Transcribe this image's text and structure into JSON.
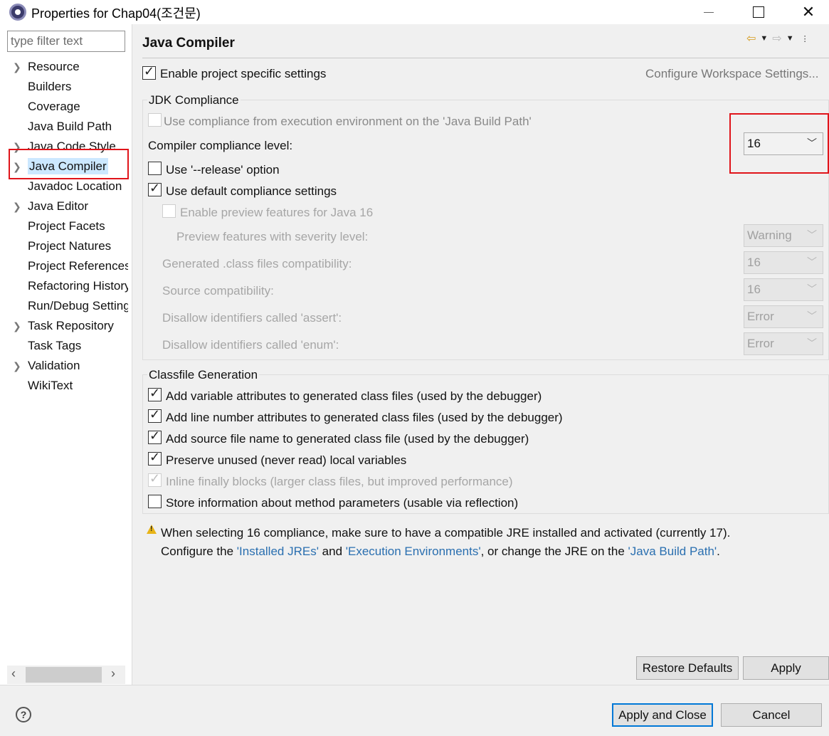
{
  "window": {
    "title": "Properties for Chap04(조건문)",
    "close_glyph": "✕"
  },
  "sidebar": {
    "filter_placeholder": "type filter text",
    "items": [
      {
        "label": "Resource",
        "expandable": true
      },
      {
        "label": "Builders",
        "expandable": false
      },
      {
        "label": "Coverage",
        "expandable": false
      },
      {
        "label": "Java Build Path",
        "expandable": false
      },
      {
        "label": "Java Code Style",
        "expandable": true
      },
      {
        "label": "Java Compiler",
        "expandable": true,
        "selected": true
      },
      {
        "label": "Javadoc Location",
        "expandable": false
      },
      {
        "label": "Java Editor",
        "expandable": true
      },
      {
        "label": "Project Facets",
        "expandable": false
      },
      {
        "label": "Project Natures",
        "expandable": false
      },
      {
        "label": "Project References",
        "expandable": false
      },
      {
        "label": "Refactoring History",
        "expandable": false
      },
      {
        "label": "Run/Debug Settings",
        "expandable": false
      },
      {
        "label": "Task Repository",
        "expandable": true
      },
      {
        "label": "Task Tags",
        "expandable": false
      },
      {
        "label": "Validation",
        "expandable": true
      },
      {
        "label": "WikiText",
        "expandable": false
      }
    ]
  },
  "page": {
    "title": "Java Compiler",
    "enable_project_specific": {
      "label": "Enable project specific settings",
      "checked": true
    },
    "configure_workspace_link": "Configure Workspace Settings...",
    "jdk_compliance": {
      "group_title": "JDK Compliance",
      "use_compliance_from_env": {
        "label": "Use compliance from execution environment on the 'Java Build Path'",
        "checked": false,
        "enabled": false
      },
      "compliance_level_label": "Compiler compliance level:",
      "compliance_level_value": "16",
      "use_release": {
        "label": "Use '--release' option",
        "checked": false
      },
      "use_default": {
        "label": "Use default compliance settings",
        "checked": true
      },
      "enable_preview": {
        "label": "Enable preview features for Java 16",
        "checked": false,
        "enabled": false
      },
      "preview_severity": {
        "label": "Preview features with severity level:",
        "value": "Warning"
      },
      "generated_class": {
        "label": "Generated .class files compatibility:",
        "value": "16"
      },
      "source_compat": {
        "label": "Source compatibility:",
        "value": "16"
      },
      "disallow_assert": {
        "label": "Disallow identifiers called 'assert':",
        "value": "Error"
      },
      "disallow_enum": {
        "label": "Disallow identifiers called 'enum':",
        "value": "Error"
      }
    },
    "classfile_generation": {
      "group_title": "Classfile Generation",
      "options": [
        {
          "label": "Add variable attributes to generated class files (used by the debugger)",
          "checked": true,
          "enabled": true
        },
        {
          "label": "Add line number attributes to generated class files (used by the debugger)",
          "checked": true,
          "enabled": true
        },
        {
          "label": "Add source file name to generated class file (used by the debugger)",
          "checked": true,
          "enabled": true
        },
        {
          "label": "Preserve unused (never read) local variables",
          "checked": true,
          "enabled": true
        },
        {
          "label": "Inline finally blocks (larger class files, but improved performance)",
          "checked": true,
          "enabled": false
        },
        {
          "label": "Store information about method parameters (usable via reflection)",
          "checked": false,
          "enabled": true
        }
      ]
    },
    "warning": {
      "line1": "When selecting 16 compliance, make sure to have a compatible JRE installed and activated (currently 17).",
      "line2_prefix": "Configure the ",
      "link_installed_jres": "'Installed JREs'",
      "and": " and ",
      "link_exec_env": "'Execution Environments'",
      "line2_mid": ", or change the JRE on the ",
      "link_build_path": "'Java Build Path'",
      "line2_suffix": "."
    },
    "restore_defaults_label": "Restore Defaults",
    "apply_label": "Apply"
  },
  "footer": {
    "help_glyph": "?",
    "apply_and_close_label": "Apply and Close",
    "cancel_label": "Cancel"
  },
  "colors": {
    "accent": "#0078d7",
    "highlight": "#e0141a",
    "link": "#2a6fb0",
    "selection": "#cce8ff"
  }
}
